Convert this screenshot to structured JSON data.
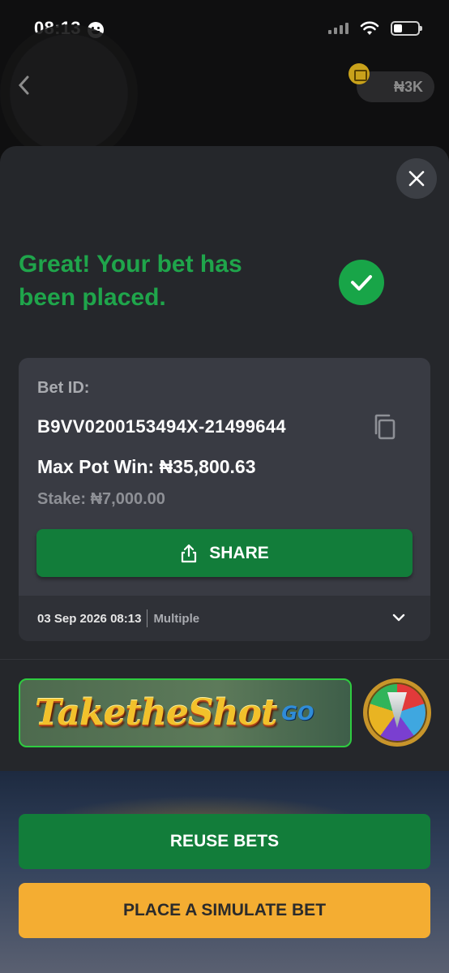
{
  "status_bar": {
    "time": "08:13"
  },
  "header": {
    "balance": "₦3K"
  },
  "sheet": {
    "title": "Great! Your bet has been placed.",
    "bet": {
      "id_label": "Bet ID:",
      "id_value": "B9VV0200153494X-21499644",
      "max_pot_win": "Max Pot Win: ₦35,800.63",
      "stake": "Stake: ₦7,000.00",
      "share_label": "SHARE",
      "date": "03 Sep 2026 08:13",
      "bet_type": "Multiple"
    },
    "promo": {
      "title": "TaketheShot",
      "suffix": "GO"
    },
    "actions": {
      "reuse_label": "REUSE BETS",
      "simulate_label": "PLACE A SIMULATE BET"
    }
  },
  "colors": {
    "accent_green": "#1fa54b",
    "button_green": "#127d3a",
    "button_yellow": "#f4ad32",
    "card_bg": "#393b43",
    "sheet_bg": "#25272b"
  }
}
